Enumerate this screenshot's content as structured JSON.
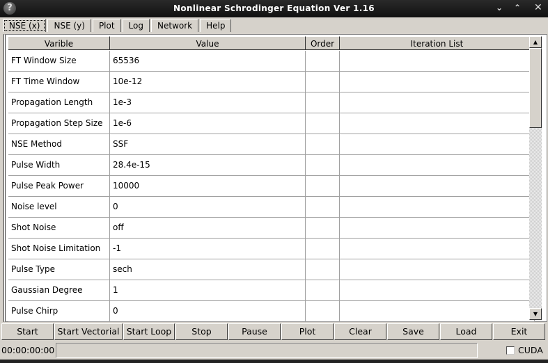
{
  "window": {
    "title": "Nonlinear Schrodinger Equation Ver 1.16",
    "help_icon": "?",
    "minimize_icon": "⌄",
    "maximize_icon": "⌃",
    "close_icon": "✕"
  },
  "tabs": [
    {
      "label": "NSE (x)",
      "active": true
    },
    {
      "label": "NSE (y)"
    },
    {
      "label": "Plot"
    },
    {
      "label": "Log"
    },
    {
      "label": "Network"
    },
    {
      "label": "Help"
    }
  ],
  "table": {
    "headers": [
      "Varible",
      "Value",
      "Order",
      "Iteration List"
    ],
    "rows": [
      {
        "variable": "FT Window Size",
        "value": "65536",
        "order": "",
        "iteration": ""
      },
      {
        "variable": "FT Time Window",
        "value": "10e-12",
        "order": "",
        "iteration": ""
      },
      {
        "variable": "Propagation Length",
        "value": "1e-3",
        "order": "",
        "iteration": ""
      },
      {
        "variable": "Propagation Step Size",
        "value": "1e-6",
        "order": "",
        "iteration": ""
      },
      {
        "variable": "NSE Method",
        "value": "SSF",
        "order": "",
        "iteration": ""
      },
      {
        "variable": "Pulse Width",
        "value": "28.4e-15",
        "order": "",
        "iteration": ""
      },
      {
        "variable": "Pulse Peak Power",
        "value": "10000",
        "order": "",
        "iteration": ""
      },
      {
        "variable": "Noise level",
        "value": "0",
        "order": "",
        "iteration": ""
      },
      {
        "variable": "Shot Noise",
        "value": "off",
        "order": "",
        "iteration": ""
      },
      {
        "variable": "Shot Noise Limitation",
        "value": "-1",
        "order": "",
        "iteration": ""
      },
      {
        "variable": "Pulse Type",
        "value": "sech",
        "order": "",
        "iteration": ""
      },
      {
        "variable": "Gaussian Degree",
        "value": "1",
        "order": "",
        "iteration": ""
      },
      {
        "variable": "Pulse Chirp",
        "value": "0",
        "order": "",
        "iteration": ""
      }
    ]
  },
  "scrollbar": {
    "up_icon": "▲",
    "down_icon": "▼"
  },
  "buttons": [
    "Start",
    "Start Vectorial",
    "Start Loop",
    "Stop",
    "Pause",
    "Plot",
    "Clear",
    "Save",
    "Load",
    "Exit"
  ],
  "status": {
    "elapsed_time": "00:00:00:00",
    "progress": 0,
    "cuda_label": "CUDA",
    "cuda_checked": false
  }
}
